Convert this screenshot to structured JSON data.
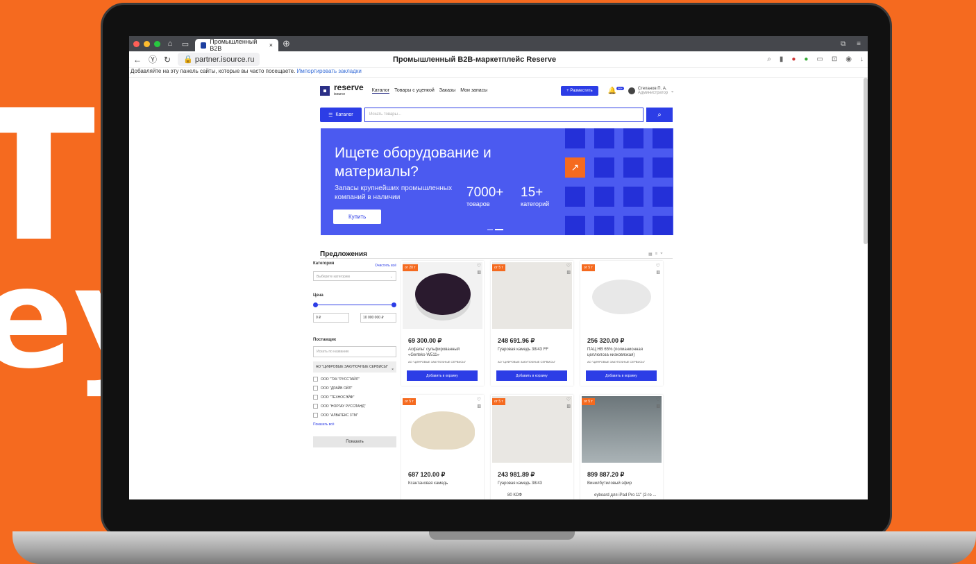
{
  "background": {
    "text1": "T",
    "text2": "еу"
  },
  "browser": {
    "tab_title": "Промышленный B2B",
    "url": "partner.isource.ru",
    "page_title": "Промышленный B2B-маркетплейс Reserve",
    "bookmark_bar_text": "Добавляйте на эту панель сайты, которые вы часто посещаете.",
    "bookmark_import": "Импортировать закладки"
  },
  "site": {
    "logo": "reserve",
    "logo_sub": "isource",
    "menu": [
      "Каталог",
      "Товары с уценкой",
      "Заказы",
      "Мои запасы"
    ],
    "place_button": "+ Разместить",
    "notif_count": "99+",
    "user_name": "Степанов П. А.",
    "user_role": "Администратор",
    "catalog_button": "Каталог",
    "search_placeholder": "Искать товары..."
  },
  "banner": {
    "title": "Ищете оборудование и материалы?",
    "subtitle": "Запасы крупнейших промышленных компаний в наличии",
    "stat1_value": "7000+",
    "stat1_label": "товаров",
    "stat2_value": "15+",
    "stat2_label": "категорий",
    "buy_button": "Купить"
  },
  "offers": {
    "title": "Предложения"
  },
  "filters": {
    "category_label": "Категория",
    "clear_all": "Очистить всё",
    "category_placeholder": "Выберите категорию",
    "price_label": "Цена",
    "price_min": "0 ₽",
    "price_max": "10 000 000 ₽",
    "supplier_label": "Поставщик",
    "supplier_search": "Искать по названию",
    "selected_supplier": "АО \"ЦИФРОВЫЕ ЗАКУПОЧНЫЕ СЕРВИСЫ\"",
    "suppliers": [
      "ООО \"ТХК \"РУССТАЙЛ\"",
      "ООО \"ДРАЙВ ОЙЛ\"",
      "ООО \"ТЕХНОСЭЙФ\"",
      "ООО \"НОРГАУ РУССЛАНД\"",
      "ООО \"АЛВАТЕКС 3ТМ\""
    ],
    "show_all": "Показать всё",
    "show_button": "Показать"
  },
  "products": [
    {
      "badge": "от 20 т",
      "price": "69 300.00 ₽",
      "name": "Асфальт сульфированный «Gerteks-W511»",
      "seller": "АО \"ЦИФРОВЫЕ ЗАКУПОЧНЫЕ СЕРВИСЫ\"",
      "add": "Добавить в корзину",
      "img_color": "#2a1a2e"
    },
    {
      "badge": "от 5 т",
      "price": "248 691.96 ₽",
      "name": "Гуаровая камедь 38/43 FF",
      "seller": "АО \"ЦИФРОВЫЕ ЗАКУПОЧНЫЕ СЕРВИСЫ\"",
      "add": "Добавить в корзину",
      "img_color": "#e9e7e3"
    },
    {
      "badge": "от 5 т",
      "price": "256 320.00 ₽",
      "name": "ПАЦ НВ 65% (полианионная целлюлоза низковязкая)",
      "seller": "АО \"ЦИФРОВЫЕ ЗАКУПОЧНЫЕ СЕРВИСЫ\"",
      "add": "Добавить в корзину",
      "img_color": "#ffffff"
    },
    {
      "badge": "от 5 т",
      "price": "687 120.00 ₽",
      "name": "Ксантановая камедь",
      "seller": "",
      "add": "",
      "img_color": "#e6dbc4"
    },
    {
      "badge": "от 5 т",
      "price": "243 981.89 ₽",
      "name": "Гуаровая камедь 38/43",
      "seller": "",
      "add": "",
      "img_color": "#e9e7e3"
    },
    {
      "badge": "от 5 т",
      "price": "899 887.20 ₽",
      "name": "Винилбутиловый эфир",
      "seller": "",
      "add": "",
      "img_color": "#9aa4a8"
    }
  ],
  "bottom": {
    "text1": "80 КОФ",
    "text2": "eyboard для iPad Pro 11\" (2-го ..."
  }
}
